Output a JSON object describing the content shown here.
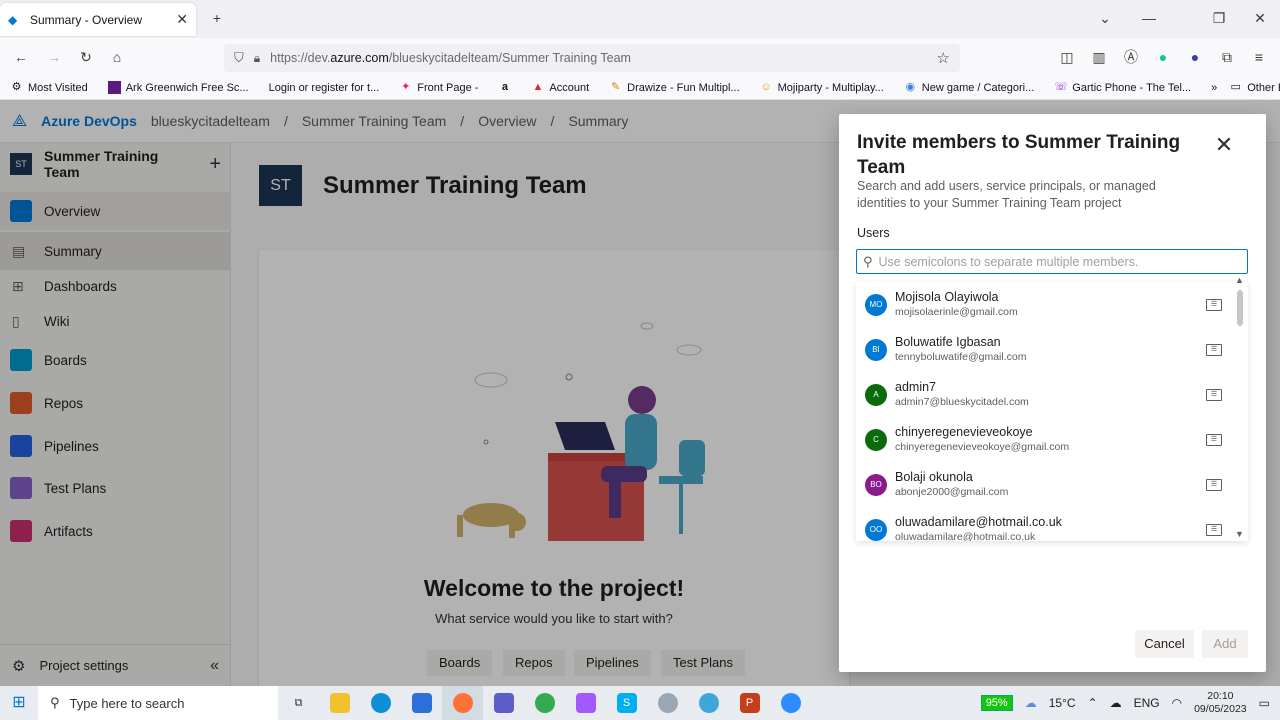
{
  "browser": {
    "tab_title": "Summary - Overview",
    "url_prefix": "https://dev.",
    "url_domain": "azure.com",
    "url_path": "/blueskycitadelteam/Summer Training Team",
    "bookmarks": [
      "Most Visited",
      "Ark Greenwich Free Sc...",
      "Login or register for t...",
      "Front Page -",
      "a",
      "Account",
      "Drawize - Fun Multipl...",
      "Mojiparty - Multiplay...",
      "New game / Categori...",
      "Gartic Phone - The Tel..."
    ],
    "other_bookmarks": "Other Bookmarks"
  },
  "app": {
    "brand": "Azure DevOps",
    "breadcrumb": [
      "blueskycitadelteam",
      "/",
      "Summer Training Team",
      "/",
      "Overview",
      "/",
      "Summary"
    ]
  },
  "sidebar": {
    "project_initials": "ST",
    "project_name": "Summer Training Team",
    "items": [
      {
        "label": "Overview",
        "color": "#0078d4"
      },
      {
        "label": "Summary"
      },
      {
        "label": "Dashboards"
      },
      {
        "label": "Wiki"
      },
      {
        "label": "Boards",
        "color": "#009ccc"
      },
      {
        "label": "Repos",
        "color": "#e05b29"
      },
      {
        "label": "Pipelines",
        "color": "#2560e0"
      },
      {
        "label": "Test Plans",
        "color": "#8661c5"
      },
      {
        "label": "Artifacts",
        "color": "#cb2e6d"
      }
    ],
    "settings": "Project settings"
  },
  "main": {
    "project_initials": "ST",
    "project_title": "Summer Training Team",
    "welcome": "Welcome to the project!",
    "welcome_sub": "What service would you like to start with?",
    "services": [
      "Boards",
      "Repos",
      "Pipelines",
      "Test Plans"
    ]
  },
  "dialog": {
    "title": "Invite members to Summer Training Team",
    "subtitle": "Search and add users, service principals, or managed identities to your Summer Training Team project",
    "users_label": "Users",
    "search_placeholder": "Use semicolons to separate multiple members.",
    "results": [
      {
        "initials": "MO",
        "name": "Mojisola Olayiwola",
        "email": "mojisolaerinle@gmail.com",
        "color": "#0078d4"
      },
      {
        "initials": "BI",
        "name": "Boluwatife Igbasan",
        "email": "tennyboluwatife@gmail.com",
        "color": "#0078d4"
      },
      {
        "initials": "A",
        "name": "admin7",
        "email": "admin7@blueskycitadel.com",
        "color": "#0b6a0b"
      },
      {
        "initials": "C",
        "name": "chinyeregenevieveokoye",
        "email": "chinyeregenevieveokoye@gmail.com",
        "color": "#0b6a0b"
      },
      {
        "initials": "BO",
        "name": "Bolaji okunola",
        "email": "abonje2000@gmail.com",
        "color": "#8b1a8b"
      },
      {
        "initials": "OO",
        "name": "oluwadamilare@hotmail.co.uk",
        "email": "oluwadamilare@hotmail.co.uk",
        "color": "#0078d4"
      }
    ],
    "cancel": "Cancel",
    "add": "Add"
  },
  "taskbar": {
    "search_placeholder": "Type here to search",
    "battery": "95%",
    "temperature": "15°C",
    "lang": "ENG",
    "time": "20:10",
    "date": "09/05/2023"
  }
}
